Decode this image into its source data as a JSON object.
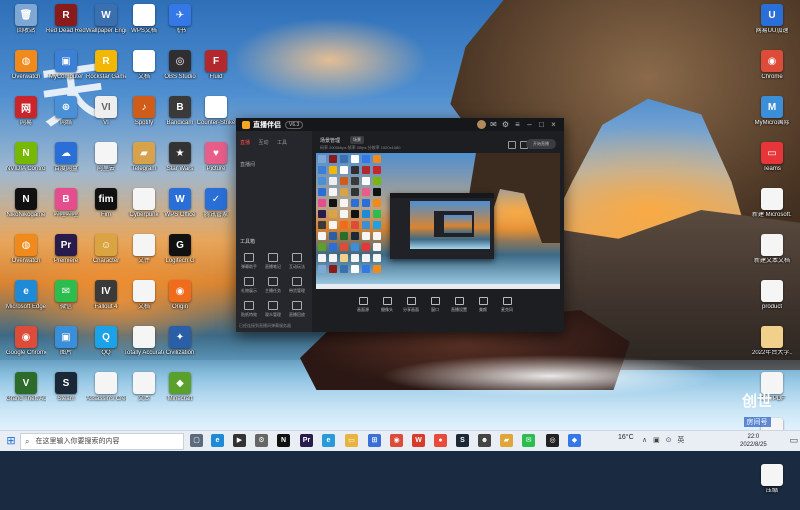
{
  "taskbar": {
    "search_placeholder": "在这里输入你要搜索的内容",
    "temperature": "16°C",
    "tray_glyphs": "∧ ▣ ⊙ 英",
    "clock_time": "22:0",
    "clock_date": "2022/8/25",
    "pinned": [
      {
        "name": "taskview",
        "color": "#5b6b7d",
        "glyph": "▢"
      },
      {
        "name": "edge",
        "color": "#1f8bd6",
        "glyph": "e"
      },
      {
        "name": "videoplayer",
        "color": "#333",
        "glyph": "▶"
      },
      {
        "name": "gear",
        "color": "#666",
        "glyph": "⚙"
      },
      {
        "name": "notion",
        "color": "#111",
        "glyph": "N"
      },
      {
        "name": "premiere",
        "color": "#2a1b4d",
        "glyph": "Pr"
      },
      {
        "name": "edge2",
        "color": "#2a9bd8",
        "glyph": "e"
      },
      {
        "name": "explorer",
        "color": "#e8b441",
        "glyph": "▭"
      },
      {
        "name": "store",
        "color": "#3a6fd8",
        "glyph": "⊞"
      },
      {
        "name": "chrome",
        "color": "#dd4b39",
        "glyph": "◉"
      },
      {
        "name": "wps",
        "color": "#d83b2b",
        "glyph": "W"
      },
      {
        "name": "record",
        "color": "#e84b3c",
        "glyph": "●"
      },
      {
        "name": "steam",
        "color": "#1b2838",
        "glyph": "S"
      },
      {
        "name": "game",
        "color": "#444",
        "glyph": "☻"
      },
      {
        "name": "folder",
        "color": "#e0a63a",
        "glyph": "▰"
      },
      {
        "name": "wechat",
        "color": "#2dbd4e",
        "glyph": "✉"
      },
      {
        "name": "obs",
        "color": "#222",
        "glyph": "◎"
      },
      {
        "name": "blue",
        "color": "#3478e8",
        "glyph": "◆"
      }
    ]
  },
  "desktop_icons": [
    {
      "label": "回收站",
      "color": "#7fa7d4",
      "glyph": "🗑"
    },
    {
      "label": "Red Dead Redempti...",
      "color": "#8b1a1a",
      "glyph": "R"
    },
    {
      "label": "Wallpaper Engine",
      "color": "#3a6fb0",
      "glyph": "W"
    },
    {
      "label": "WPS文档",
      "color": "#ffffff",
      "glyph": ""
    },
    {
      "label": "飞书",
      "color": "#3478e8",
      "glyph": "✈"
    },
    {
      "label": "Overwatch",
      "color": "#f08a1c",
      "glyph": "◍"
    },
    {
      "label": "MyComputer",
      "color": "#3b7fd6",
      "glyph": "▣"
    },
    {
      "label": "Rockstar Games...",
      "color": "#f2b705",
      "glyph": "R"
    },
    {
      "label": "文档",
      "color": "#ffffff",
      "glyph": ""
    },
    {
      "label": "OBS Studio",
      "color": "#302e31",
      "glyph": "◎"
    },
    {
      "label": "Fluid",
      "color": "#b3282d",
      "glyph": "F"
    },
    {
      "label": "网易",
      "color": "#c9262c",
      "glyph": "网"
    },
    {
      "label": "网络",
      "color": "#4a90d9",
      "glyph": "⊕"
    },
    {
      "label": "VI",
      "color": "#eee",
      "glyph": "VI"
    },
    {
      "label": "Spotify",
      "color": "#d05c1a",
      "glyph": "♪"
    },
    {
      "label": "Bandicam",
      "color": "#3a3a3a",
      "glyph": "B"
    },
    {
      "label": "Counter-Strike",
      "color": "#ffffff",
      "glyph": ""
    },
    {
      "label": "NVIDIA Control",
      "color": "#76b900",
      "glyph": "N"
    },
    {
      "label": "百度网盘",
      "color": "#2a6fd8",
      "glyph": "☁"
    },
    {
      "label": "阿里云",
      "color": "#f5f5f5",
      "glyph": ""
    },
    {
      "label": "Telegram",
      "color": "#d8a24a",
      "glyph": "▰"
    },
    {
      "label": "Star Wars",
      "color": "#333",
      "glyph": "★"
    },
    {
      "label": "Picture",
      "color": "#e85d8a",
      "glyph": "♥"
    },
    {
      "label": "NikoNikogame",
      "color": "#111",
      "glyph": "N"
    },
    {
      "label": "哔哩哔哩",
      "color": "#e64d8e",
      "glyph": "B"
    },
    {
      "label": "Fim",
      "color": "#111",
      "glyph": "fim"
    },
    {
      "label": "Cyberpunk",
      "color": "#f5f5f5",
      "glyph": ""
    },
    {
      "label": "WPS Office",
      "color": "#2a6fd8",
      "glyph": "W"
    },
    {
      "label": "腾讯管家",
      "color": "#2a6fd8",
      "glyph": "✓"
    },
    {
      "label": "Overwatch",
      "color": "#f08a1c",
      "glyph": "◍"
    },
    {
      "label": "Premiere",
      "color": "#2a1b4d",
      "glyph": "Pr"
    },
    {
      "label": "Character",
      "color": "#d9a441",
      "glyph": "☺"
    },
    {
      "label": "文件",
      "color": "#f5f5f5",
      "glyph": ""
    },
    {
      "label": "Logitech G",
      "color": "#111",
      "glyph": "G"
    },
    {
      "label": "Microsoft Edge",
      "color": "#1f8bd6",
      "glyph": "e"
    },
    {
      "label": "微信",
      "color": "#2dbd4e",
      "glyph": "✉"
    },
    {
      "label": "Fallout 4",
      "color": "#3a3a3a",
      "glyph": "IV"
    },
    {
      "label": "文档",
      "color": "#f5f5f5",
      "glyph": ""
    },
    {
      "label": "Origin",
      "color": "#f06b1c",
      "glyph": "◉"
    },
    {
      "label": "Google Chrome",
      "color": "#dd4b39",
      "glyph": "◉"
    },
    {
      "label": "图片",
      "color": "#3a8fd8",
      "glyph": "▣"
    },
    {
      "label": "QQ",
      "color": "#1aa3e8",
      "glyph": "Q"
    },
    {
      "label": "Totally Accurate...",
      "color": "#f5f5f5",
      "glyph": ""
    },
    {
      "label": "Civilization",
      "color": "#2a5fa8",
      "glyph": "✦"
    },
    {
      "label": "Grand Theft Auto V",
      "color": "#2d6b2a",
      "glyph": "V"
    },
    {
      "label": "Steam",
      "color": "#1b2838",
      "glyph": "S"
    },
    {
      "label": "Assassin's Creed",
      "color": "#f5f5f5",
      "glyph": ""
    },
    {
      "label": "文本",
      "color": "#f5f5f5",
      "glyph": ""
    },
    {
      "label": "Minecraft",
      "color": "#5aa02c",
      "glyph": "◆"
    },
    {
      "label": "网易UU加速",
      "color": "#2a6fd8",
      "glyph": "U"
    },
    {
      "label": "Chrome",
      "color": "#dd4b39",
      "glyph": "◉"
    },
    {
      "label": "MyMicro国际",
      "color": "#3a8fd8",
      "glyph": "M"
    },
    {
      "label": "Teams",
      "color": "#e8353a",
      "glyph": "▭"
    },
    {
      "label": "新建 Microsoft...",
      "color": "#f5f5f5",
      "glyph": ""
    },
    {
      "label": "新建文本文档",
      "color": "#f5f5f5",
      "glyph": ""
    },
    {
      "label": "product",
      "color": "#f5f5f5",
      "glyph": ""
    },
    {
      "label": "2022年台大学...",
      "color": "#f0d08a",
      "glyph": ""
    },
    {
      "label": "文档 PDF",
      "color": "#f5f5f5",
      "glyph": ""
    },
    {
      "label": "文档",
      "color": "#f5f5f5",
      "glyph": ""
    },
    {
      "label": "压缩",
      "color": "#f5f5f5",
      "glyph": ""
    }
  ],
  "app": {
    "name": "直播伴侣",
    "version": "V6.3",
    "tabs": [
      "直播",
      "互动",
      "工具"
    ],
    "workspace_label": "直播间",
    "tools_label": "工具箱",
    "tools": [
      "弹幕助手",
      "直播笔记",
      "互动玩法",
      "礼物展示",
      "主播任务",
      "带货管理",
      "贴纸特效",
      "观众管理",
      "直播回放"
    ],
    "footer": "已经连接到直播间弹幕服务器",
    "scene_title": "场景管理",
    "scene_badge": "场景",
    "info_row": "码率 2000kbps  帧率 30fps  分辨率 1920x1080",
    "controls": [
      "画面源",
      "摄像头",
      "分享画面",
      "窗口",
      "直播设置",
      "美颜",
      "麦克风"
    ],
    "live_button": "开始直播"
  },
  "watermark": {
    "main": "创世",
    "sub": "房间号",
    "id": "3430886"
  }
}
